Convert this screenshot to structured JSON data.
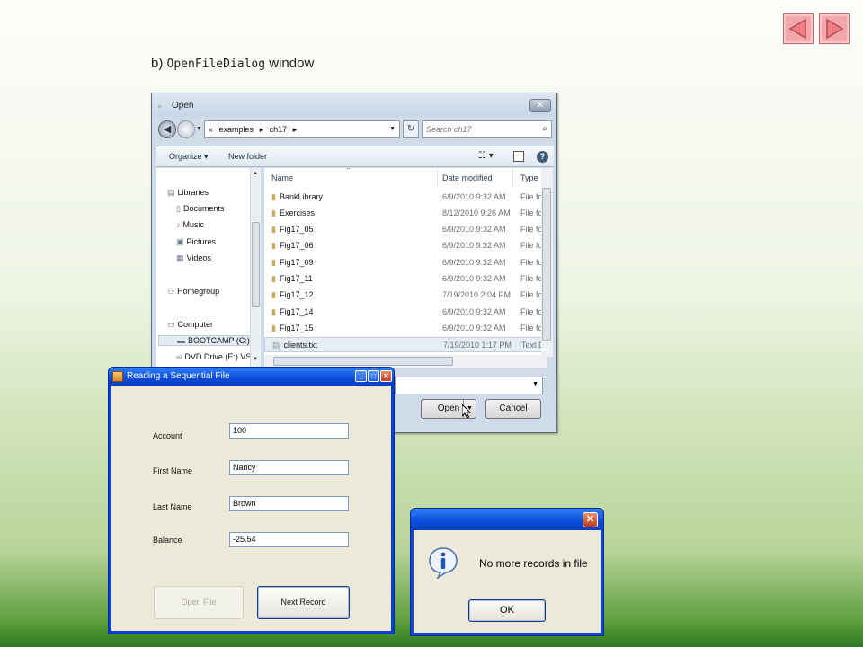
{
  "caption": {
    "prefix": "b)",
    "code": "OpenFileDialog",
    "suffix": "window"
  },
  "open_dialog": {
    "title": "Open",
    "address_overflow": "«",
    "address": [
      "examples",
      "ch17"
    ],
    "search_placeholder": "Search ch17",
    "toolbar": {
      "organize": "Organize ▾",
      "new_folder": "New folder",
      "views": "☷ ▾",
      "help": "?"
    },
    "nav": [
      {
        "label": "Libraries",
        "icon": "libraries-icon",
        "glyph": "▤"
      },
      {
        "label": "Documents",
        "icon": "documents-icon",
        "glyph": "▯"
      },
      {
        "label": "Music",
        "icon": "music-icon",
        "glyph": "♪"
      },
      {
        "label": "Pictures",
        "icon": "pictures-icon",
        "glyph": "▣"
      },
      {
        "label": "Videos",
        "icon": "videos-icon",
        "glyph": "▦"
      },
      {
        "label": "Homegroup",
        "icon": "homegroup-icon",
        "glyph": "⚇"
      },
      {
        "label": "Computer",
        "icon": "computer-icon",
        "glyph": "▭"
      },
      {
        "label": "BOOTCAMP (C:)",
        "icon": "drive-icon",
        "glyph": "▬"
      },
      {
        "label": "DVD Drive (E:) VS",
        "icon": "dvd-drive-icon",
        "glyph": "∞"
      }
    ],
    "columns": {
      "name": "Name",
      "date": "Date modified",
      "type": "Type"
    },
    "files": [
      {
        "name": "BankLibrary",
        "date": "6/9/2010 9:32 AM",
        "type": "File fol"
      },
      {
        "name": "Exercises",
        "date": "8/12/2010 9:26 AM",
        "type": "File fol"
      },
      {
        "name": "Fig17_05",
        "date": "6/9/2010 9:32 AM",
        "type": "File fol"
      },
      {
        "name": "Fig17_06",
        "date": "6/9/2010 9:32 AM",
        "type": "File fol"
      },
      {
        "name": "Fig17_09",
        "date": "6/9/2010 9:32 AM",
        "type": "File fol"
      },
      {
        "name": "Fig17_11",
        "date": "6/9/2010 9:32 AM",
        "type": "File fol"
      },
      {
        "name": "Fig17_12",
        "date": "7/19/2010 2:04 PM",
        "type": "File fol"
      },
      {
        "name": "Fig17_14",
        "date": "6/9/2010 9:32 AM",
        "type": "File fol"
      },
      {
        "name": "Fig17_15",
        "date": "6/9/2010 9:32 AM",
        "type": "File fol"
      },
      {
        "name": "clients.txt",
        "date": "7/19/2010 1:17 PM",
        "type": "Text D"
      }
    ],
    "open_label": "Open",
    "cancel_label": "Cancel"
  },
  "form": {
    "title": "Reading a Sequential File",
    "fields": [
      {
        "label": "Account",
        "value": "100"
      },
      {
        "label": "First Name",
        "value": "Nancy"
      },
      {
        "label": "Last Name",
        "value": "Brown"
      },
      {
        "label": "Balance",
        "value": "-25.54"
      }
    ],
    "open_file": "Open File",
    "next_record": "Next Record"
  },
  "message": {
    "text": "No more records in file",
    "ok": "OK"
  },
  "colors": {
    "nav_button": "#f4a7a9",
    "xp_title": "#0b4bd9",
    "xp_face": "#ece9d8",
    "win7_frame": "#cfdbe8"
  }
}
